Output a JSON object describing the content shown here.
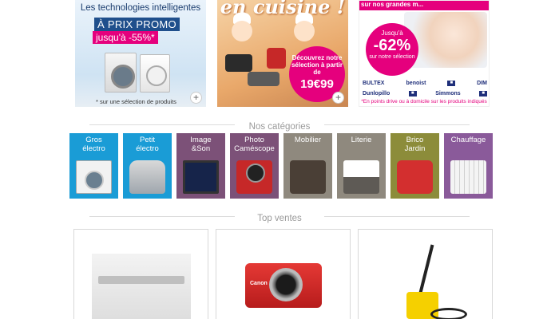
{
  "banners": [
    {
      "id": "technologies",
      "headline": "Les technologies intelligentes",
      "promo": "À PRIX PROMO",
      "subline": "jusqu'à -55%*",
      "footnote": "* sur une sélection de produits"
    },
    {
      "id": "cuisine",
      "headline": "en cuisine !",
      "disc_line1": "Découvrez notre sélection à partir de",
      "disc_price": "19€99"
    },
    {
      "id": "literie",
      "headline": "sur nos grandes m...",
      "disc_top": "Jusqu'à",
      "disc_value": "-62%",
      "disc_bottom": "sur notre sélection",
      "brands_row1": [
        "BULTEX",
        "benoist",
        "■",
        "DIM"
      ],
      "brands_row2": [
        "Dunlopillo",
        "■",
        "Simmons",
        "■"
      ],
      "footnote": "*En points drive ou à domicile sur les produits indiqués"
    }
  ],
  "plus_label": "+",
  "sections": {
    "categories_title": "Nos catégories",
    "top_title": "Top ventes"
  },
  "categories": [
    {
      "label": "Gros\nélectro",
      "color": "#1a9cd6",
      "icon": "washer-icon"
    },
    {
      "label": "Petit\nélectro",
      "color": "#1a9cd6",
      "icon": "food-processor-icon"
    },
    {
      "label": "Image\n&Son",
      "color": "#7c5178",
      "icon": "tv-icon"
    },
    {
      "label": "Photo\nCaméscope",
      "color": "#7c5178",
      "icon": "camera-icon"
    },
    {
      "label": "Mobilier",
      "color": "#8f897e",
      "icon": "sofa-icon"
    },
    {
      "label": "Literie",
      "color": "#8f897e",
      "icon": "bed-icon"
    },
    {
      "label": "Brico\nJardin",
      "color": "#8c8c3a",
      "icon": "lawnmower-icon"
    },
    {
      "label": "Chauffage",
      "color": "#8a5a9a",
      "icon": "radiator-icon"
    }
  ],
  "top_products": [
    {
      "name": "range-hood"
    },
    {
      "name": "compact-camera",
      "brand": "Canon"
    },
    {
      "name": "pressure-washer"
    }
  ]
}
